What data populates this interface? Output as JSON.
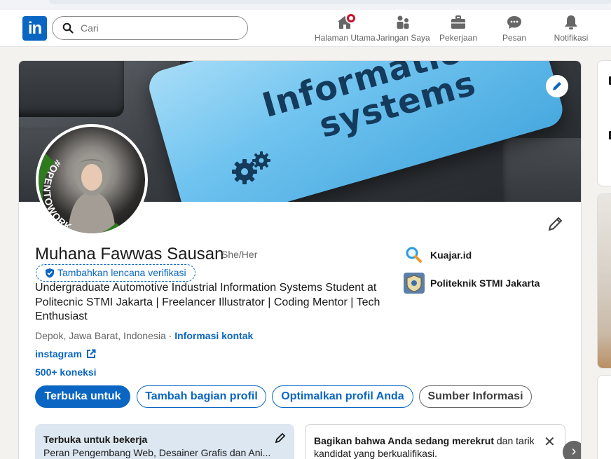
{
  "nav": {
    "logo": "in",
    "search_placeholder": "Cari",
    "items": [
      {
        "label": "Halaman Utama",
        "icon": "home-icon"
      },
      {
        "label": "Jaringan Saya",
        "icon": "network-icon"
      },
      {
        "label": "Pekerjaan",
        "icon": "briefcase-icon"
      },
      {
        "label": "Pesan",
        "icon": "message-icon"
      },
      {
        "label": "Notifikasi",
        "icon": "bell-icon"
      }
    ]
  },
  "banner": {
    "line1": "Information",
    "line2": "systems"
  },
  "avatar": {
    "frame_text": "#OPENTOWORK",
    "frame_color": "#2f7a1f"
  },
  "profile": {
    "name": "Muhana Fawwas Sausan",
    "pronoun": "She/Her",
    "verify_label": "Tambahkan lencana verifikasi",
    "headline": "Undergraduate Automotive Industrial Information Systems Student at Politecnic STMI Jakarta | Freelancer Illustrator | Coding Mentor | Tech Enthusiast",
    "location": "Depok, Jawa Barat, Indonesia",
    "location_sep": "·",
    "contact_label": "Informasi kontak",
    "website_label": "instagram",
    "connections": "500+ koneksi"
  },
  "orgs": [
    {
      "name": "Kuajar.id",
      "icon": "magnifier-logo"
    },
    {
      "name": "Politeknik STMI Jakarta",
      "icon": "school-crest-logo"
    }
  ],
  "actions": {
    "open_to": "Terbuka untuk",
    "add_section": "Tambah bagian profil",
    "optimize": "Optimalkan profil Anda",
    "resources": "Sumber Informasi"
  },
  "cards": {
    "open_title": "Terbuka untuk bekerja",
    "open_text": "Peran Pengembang Web, Desainer Grafis dan Ani...",
    "recruit_bold": "Bagikan bahwa Anda sedang merekrut",
    "recruit_rest": " dan tarik kandidat yang berkualifikasi.",
    "close_glyph": "✕",
    "next_glyph": "›"
  },
  "colors": {
    "brand": "#0a66c2",
    "notif": "#cb112d",
    "open_card_bg": "#dde7f1"
  }
}
